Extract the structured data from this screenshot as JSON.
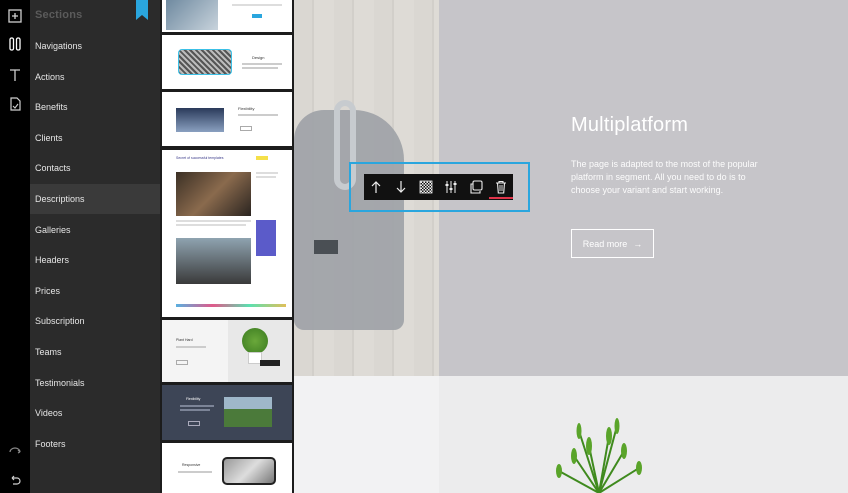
{
  "sidebar": {
    "title": "Sections",
    "items": [
      {
        "label": "Navigations"
      },
      {
        "label": "Actions"
      },
      {
        "label": "Benefits"
      },
      {
        "label": "Clients"
      },
      {
        "label": "Contacts"
      },
      {
        "label": "Descriptions",
        "active": true
      },
      {
        "label": "Galleries"
      },
      {
        "label": "Headers"
      },
      {
        "label": "Prices"
      },
      {
        "label": "Subscription"
      },
      {
        "label": "Teams"
      },
      {
        "label": "Testimonials"
      },
      {
        "label": "Videos"
      },
      {
        "label": "Footers"
      }
    ]
  },
  "rail": {
    "icons": [
      "add-section-icon",
      "sections-icon",
      "text-icon",
      "page-icon",
      "redo-icon",
      "undo-icon"
    ]
  },
  "thumbnails": {
    "design_label": "Design",
    "flexibility_label": "Flexibility",
    "gallery_heading": "Secret of successful templates",
    "gallery_tag": "Read more",
    "plant_label": "Plant Hard",
    "flexibility_dark_label": "Flexibility",
    "responsive_label": "Responsive"
  },
  "toolbar": {
    "buttons": [
      "move-up-icon",
      "move-down-icon",
      "background-icon",
      "settings-icon",
      "duplicate-icon",
      "delete-icon"
    ]
  },
  "hero": {
    "heading": "Multiplatform",
    "text": "The page is adapted to the most of the popular platform in segment. All you need to do is to choose your variant and start working.",
    "button_label": "Read more",
    "button_arrow": "→"
  },
  "colors": {
    "accent": "#2aa6de",
    "delete_accent": "#e0344a",
    "rail": "#000000",
    "menu": "#2b2b2b",
    "hero_right": "#c6c5c9"
  }
}
